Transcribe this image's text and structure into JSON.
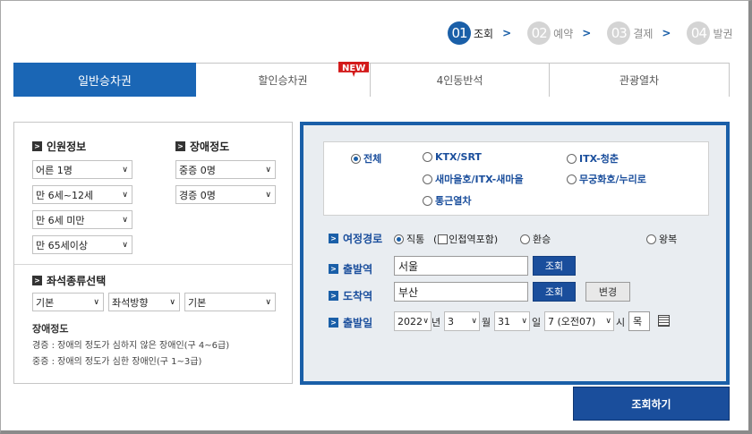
{
  "steps": [
    {
      "num": "01",
      "label": "조회",
      "active": true
    },
    {
      "num": "02",
      "label": "예약",
      "active": false
    },
    {
      "num": "03",
      "label": "결제",
      "active": false
    },
    {
      "num": "04",
      "label": "발권",
      "active": false
    }
  ],
  "tabs": [
    {
      "label": "일반승차권",
      "active": true
    },
    {
      "label": "할인승차권",
      "badge": "NEW"
    },
    {
      "label": "4인동반석"
    },
    {
      "label": "관광열차"
    }
  ],
  "passengers": {
    "title": "인원정보",
    "selects": [
      "어른 1명",
      "만 6세~12세",
      "만 6세 미만",
      "만 65세이상"
    ]
  },
  "disability": {
    "title": "장애정도",
    "selects": [
      "중증 0명",
      "경증 0명"
    ]
  },
  "seat": {
    "title": "좌석종류선택",
    "selects": [
      "기본",
      "좌석방향",
      "기본"
    ]
  },
  "note": {
    "title": "장애정도",
    "lines": [
      "경증 : 장애의 정도가 심하지 않은 장애인(구 4~6급)",
      "중증 : 장애의 정도가 심한 장애인(구 1~3급)"
    ]
  },
  "train_types": {
    "all": "전체",
    "ktx_srt": "KTX/SRT",
    "itx_cheongchun": "ITX-청춘",
    "saemaeul": "새마을호/ITX-새마을",
    "mugunghwa": "무궁화호/누리로",
    "commuter": "통근열차"
  },
  "route": {
    "label": "여정경로",
    "direct": "직통",
    "transfer_prefix": "(",
    "transfer_label": "인접역포함)",
    "transfer": "환승",
    "round": "왕복"
  },
  "departure": {
    "label": "출발역",
    "value": "서울",
    "button": "조회"
  },
  "arrival": {
    "label": "도착역",
    "value": "부산",
    "button": "조회",
    "swap": "변경"
  },
  "date": {
    "label": "출발일",
    "year": "2022",
    "year_unit": "년",
    "month": "3",
    "month_unit": "월",
    "day": "31",
    "day_unit": "일",
    "hour": "7 (오전07)",
    "hour_unit": "시",
    "weekday": "목"
  },
  "search_button": "조회하기",
  "colors": {
    "primary": "#1a5fa8",
    "dark_blue": "#1a4e9c",
    "badge_red": "#d31a1a"
  }
}
